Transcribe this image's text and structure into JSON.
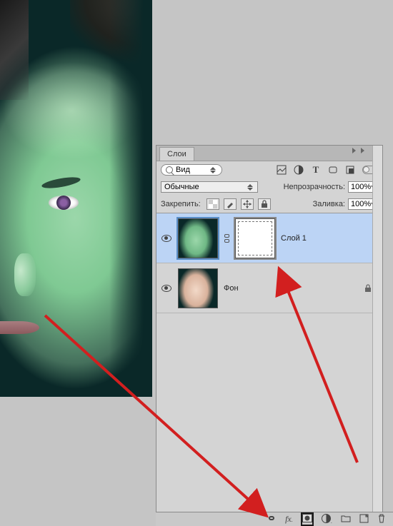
{
  "panel": {
    "title": "Слои",
    "filter_label": "Вид",
    "blend_mode": "Обычные",
    "opacity_label": "Непрозрачность:",
    "opacity_value": "100%",
    "lock_label": "Закрепить:",
    "fill_label": "Заливка:",
    "fill_value": "100%"
  },
  "layers": [
    {
      "name": "Слой 1",
      "visible": true,
      "selected": true,
      "has_mask": true,
      "locked": false,
      "thumb_variant": "green"
    },
    {
      "name": "Фон",
      "visible": true,
      "selected": false,
      "has_mask": false,
      "locked": true,
      "thumb_variant": "natural"
    }
  ],
  "icons": {
    "filter_pixel": "image-filter-icon",
    "filter_adjust": "adjustment-filter-icon",
    "filter_type": "T",
    "filter_shape": "shape-filter-icon",
    "filter_smart": "smart-filter-icon"
  },
  "bottom_icons": [
    "link-icon",
    "fx-icon",
    "mask-icon",
    "adjustment-icon",
    "group-icon",
    "new-layer-icon",
    "trash-icon"
  ],
  "colors": {
    "selection": "#bcd4f5",
    "panel_bg": "#d4d4d4",
    "arrow": "#d21f1f"
  }
}
